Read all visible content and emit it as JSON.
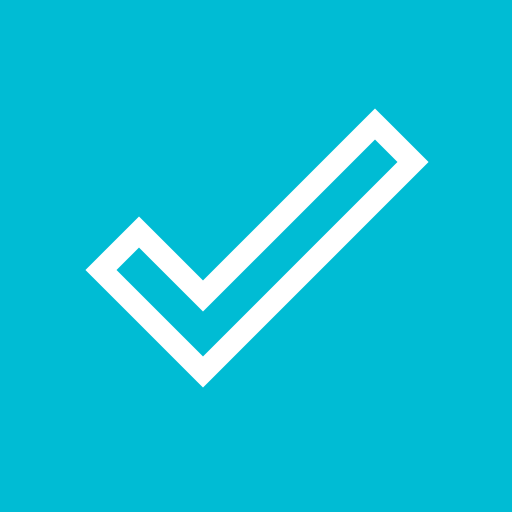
{
  "app_icon": {
    "icon": "check-icon",
    "style": "outlined",
    "colors": {
      "background": "#00BCD4",
      "glyph": "#FFFFFF"
    }
  }
}
